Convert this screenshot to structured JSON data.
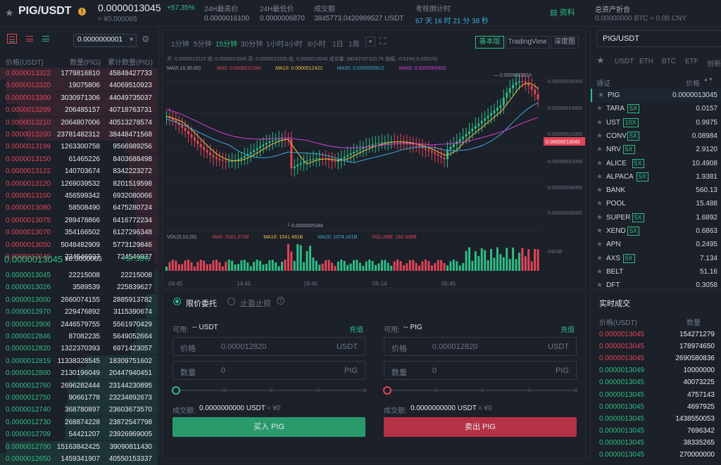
{
  "header": {
    "pair": "PIG/USDT",
    "price": "0.0000013045",
    "change": "+57.35%",
    "cny": "≈ ¥0.000065",
    "stats": [
      {
        "label": "24H最高价",
        "value": "0.0000016100"
      },
      {
        "label": "24H最低价",
        "value": "0.0000006870"
      },
      {
        "label": "成交额",
        "value": "3845773.0420999527 USDT"
      },
      {
        "label": "考核倒计时",
        "value": "67 天 16 时 21 分 38 秒"
      }
    ],
    "resource_label": "资料",
    "asset_title": "总资产折合",
    "asset_value": "0.00000000 BTC ≈ 0.00 CNY"
  },
  "book": {
    "precision": "0.0000000001",
    "headers": [
      "价格(USDT)",
      "数量(PIG)",
      "累计数量(PIG)"
    ],
    "asks": [
      [
        "0.0000013322",
        "1779816810",
        "45849427733"
      ],
      [
        "0.0000013320",
        "19075806",
        "44069510923"
      ],
      [
        "0.0000013300",
        "3030971306",
        "44049735037"
      ],
      [
        "0.0000013299",
        "206485157",
        "40718763731"
      ],
      [
        "0.0000013210",
        "2064807006",
        "40513278574"
      ],
      [
        "0.0000013200",
        "23781482312",
        "38448471568"
      ],
      [
        "0.0000013199",
        "1263300758",
        "9566989256"
      ],
      [
        "0.0000013150",
        "61465226",
        "8403688498"
      ],
      [
        "0.0000013122",
        "140703674",
        "8342223272"
      ],
      [
        "0.0000013120",
        "1269039532",
        "8201519598"
      ],
      [
        "0.0000013100",
        "456599342",
        "6932080066"
      ],
      [
        "0.0000013080",
        "58508490",
        "6475280724"
      ],
      [
        "0.0000013075",
        "289478866",
        "6416772234"
      ],
      [
        "0.0000013070",
        "354166502",
        "6127296348"
      ],
      [
        "0.0000013050",
        "5048482909",
        "5773129846"
      ],
      [
        "0.0000013049",
        "724546937",
        "724546937"
      ]
    ],
    "last_price": "0.0000013045",
    "last_cny": "¥0.0000065",
    "last_change": "+57.35%",
    "bids": [
      [
        "0.0000013045",
        "22215008",
        "22215008"
      ],
      [
        "0.0000013026",
        "3589539",
        "225839627"
      ],
      [
        "0.0000013000",
        "2660074155",
        "2885913782"
      ],
      [
        "0.0000012970",
        "229476892",
        "3115390674"
      ],
      [
        "0.0000012906",
        "2446579755",
        "5561970429"
      ],
      [
        "0.0000012846",
        "87082235",
        "5649052664"
      ],
      [
        "0.0000012820",
        "1322370393",
        "6971423057"
      ],
      [
        "0.0000012819",
        "11338328545",
        "18309751602"
      ],
      [
        "0.0000012800",
        "2130196049",
        "20447940451"
      ],
      [
        "0.0000012760",
        "2696282444",
        "23144230895"
      ],
      [
        "0.0000012750",
        "90661778",
        "23234892673"
      ],
      [
        "0.0000012740",
        "368780897",
        "23603673570"
      ],
      [
        "0.0000012730",
        "268874228",
        "23872547798"
      ],
      [
        "0.0000012709",
        "54421207",
        "23926969005"
      ],
      [
        "0.0000012700",
        "15163842425",
        "39090811430"
      ],
      [
        "0.0000012650",
        "1459341907",
        "40550153337"
      ]
    ]
  },
  "chart": {
    "timeframes": [
      "1分钟",
      "5分钟",
      "15分钟",
      "30分钟",
      "1小时",
      "4小时",
      "8小时",
      "1日",
      "1周"
    ],
    "active_timeframe": "15分钟",
    "views": [
      "基本版",
      "TradingView",
      "深度图"
    ],
    "active_view": "基本版",
    "ohlc_line": "开: 0.0000013125   收: 0.0000013045   高: 0.0000013335   低: 0.0000013045   成交量: 38243787320.76   涨幅: -0.61%(-0.0351%)",
    "ma_line": [
      {
        "text": "MA(5,10,30,60)",
        "color": "#9aa2b0"
      },
      {
        "text": "MA5: 0.0000012345",
        "color": "#e34457"
      },
      {
        "text": "MA10: 0.0000012422",
        "color": "#f0c040"
      },
      {
        "text": "MA30: 0.0000000612",
        "color": "#3fa9d8"
      },
      {
        "text": "MA60: 0.0000000400",
        "color": "#d63fd6"
      }
    ],
    "price_axis": [
      "0.00000016000",
      "0.00000014000",
      "0.00000012000",
      "0.00000010000",
      "0.00000008000",
      "0.00000006000"
    ],
    "current_price_label": "0.00000013045",
    "high_label": "0.0000001610",
    "low_label": "0.0000005348",
    "time_axis": [
      "09:45",
      "14:45",
      "19:45",
      "05-14",
      "05:45"
    ],
    "vol_line": [
      {
        "text": "VOL(5,10,20)",
        "color": "#9aa2b0"
      },
      {
        "text": "MA5: 3161.372B",
        "color": "#e34457"
      },
      {
        "text": "MA10: 1541.491B",
        "color": "#f0c040"
      },
      {
        "text": "MA20: 1074.161B",
        "color": "#3fa9d8"
      },
      {
        "text": "VOLUME: 262.438B",
        "color": "#e34457"
      }
    ],
    "vol_axis": "2403B"
  },
  "entry": {
    "tab_limit": "限价委托",
    "tab_stop": "止盈止损",
    "buy": {
      "avail_label": "可用:",
      "avail_value": "-- USDT",
      "deposit": "充值",
      "price_label": "价格",
      "price_value": "0.000012820",
      "price_unit": "USDT",
      "qty_label": "数量",
      "qty_value": "0",
      "qty_unit": "PIG",
      "total_label": "成交额:",
      "total_value": "0.0000000000 USDT",
      "total_cny": "≈ ¥0",
      "button": "买入 PIG"
    },
    "sell": {
      "avail_label": "可用:",
      "avail_value": "-- PIG",
      "deposit": "充值",
      "price_label": "价格",
      "price_value": "0.000012820",
      "price_unit": "USDT",
      "qty_label": "数量",
      "qty_value": "0",
      "qty_unit": "PIG",
      "total_label": "成交额:",
      "total_value": "0.0000000000 USDT",
      "total_cny": "≈ ¥0",
      "button": "卖出 PIG"
    }
  },
  "markets": {
    "search_value": "PIG/USDT",
    "tabs": [
      "USDT",
      "ETH",
      "BTC",
      "ETF",
      "创新"
    ],
    "headers": [
      "通证",
      "价格"
    ],
    "rows": [
      {
        "name": "PIG",
        "lev": "",
        "price": "0.0000013045"
      },
      {
        "name": "TARA",
        "lev": "5X",
        "price": "0.0157"
      },
      {
        "name": "UST",
        "lev": "10X",
        "price": "0.9975"
      },
      {
        "name": "CONV",
        "lev": "5X",
        "price": "0.08984"
      },
      {
        "name": "NRV",
        "lev": "5X",
        "price": "2.9120"
      },
      {
        "name": "ALICE",
        "lev": "5X",
        "price": "10.4908"
      },
      {
        "name": "ALPACA",
        "lev": "5X",
        "price": "1.9381"
      },
      {
        "name": "BANK",
        "lev": "",
        "price": "560.13"
      },
      {
        "name": "POOL",
        "lev": "",
        "price": "15.488"
      },
      {
        "name": "SUPER",
        "lev": "5X",
        "price": "1.6892"
      },
      {
        "name": "XEND",
        "lev": "5X",
        "price": "0.6863"
      },
      {
        "name": "APN",
        "lev": "",
        "price": "0.2495"
      },
      {
        "name": "AXS",
        "lev": "5X",
        "price": "7.134"
      },
      {
        "name": "BELT",
        "lev": "",
        "price": "51.16"
      },
      {
        "name": "DFT",
        "lev": "",
        "price": "0.3058"
      }
    ]
  },
  "trades": {
    "title": "实时成交",
    "headers": [
      "价格(USDT)",
      "数量"
    ],
    "rows": [
      {
        "price": "0.0000013045",
        "qty": "154271279",
        "side": "down"
      },
      {
        "price": "0.0000013045",
        "qty": "178974650",
        "side": "down"
      },
      {
        "price": "0.0000013045",
        "qty": "2690580836",
        "side": "down"
      },
      {
        "price": "0.0000013049",
        "qty": "10000000",
        "side": "up"
      },
      {
        "price": "0.0000013045",
        "qty": "40073225",
        "side": "up"
      },
      {
        "price": "0.0000013045",
        "qty": "4757143",
        "side": "up"
      },
      {
        "price": "0.0000013045",
        "qty": "4697925",
        "side": "up"
      },
      {
        "price": "0.0000013045",
        "qty": "1438550053",
        "side": "up"
      },
      {
        "price": "0.0000013045",
        "qty": "7696342",
        "side": "up"
      },
      {
        "price": "0.0000013045",
        "qty": "38335265",
        "side": "up"
      },
      {
        "price": "0.0000013045",
        "qty": "270000000",
        "side": "up"
      }
    ]
  },
  "colors": {
    "up": "#2fbd85",
    "down": "#e34457",
    "bg": "#1b2029"
  }
}
